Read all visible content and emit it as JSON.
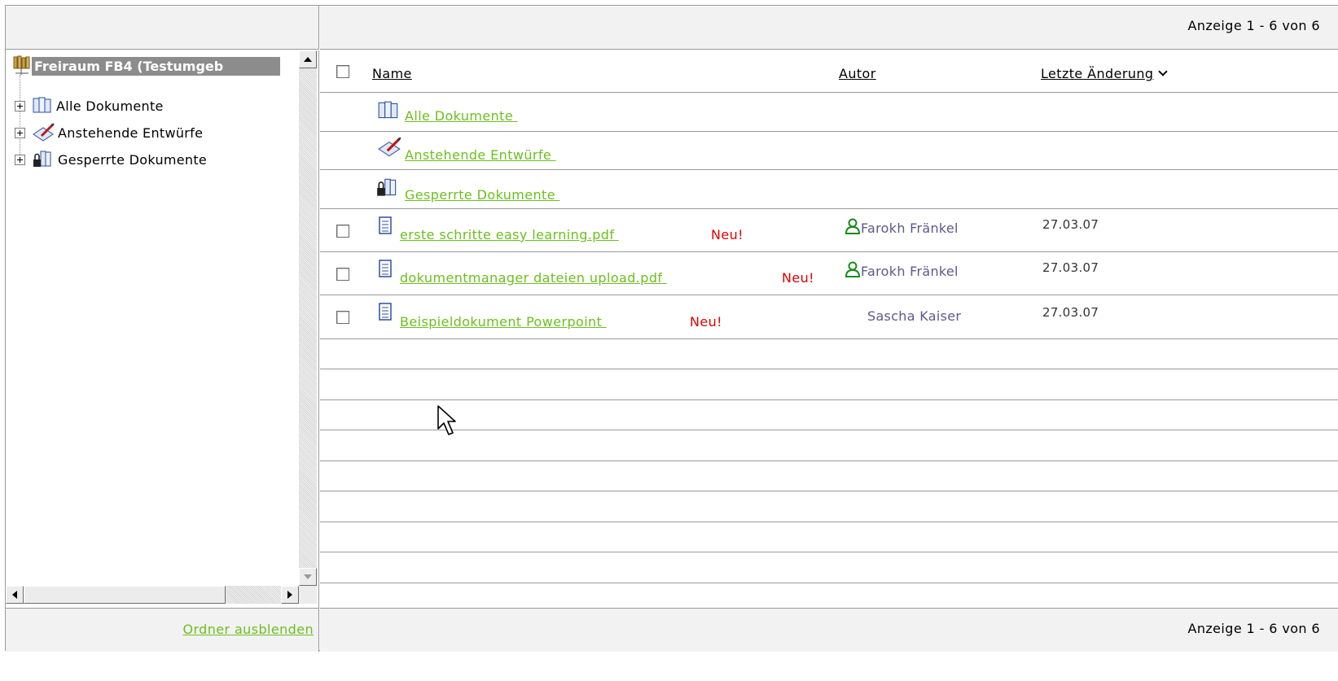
{
  "paging": {
    "top": "Anzeige 1 - 6 von 6",
    "bottom": "Anzeige 1 - 6 von 6"
  },
  "sidebar": {
    "root_label": "Freiraum FB4 (Testumgeb",
    "items": [
      {
        "label": "Alle Dokumente",
        "icon": "documents-icon"
      },
      {
        "label": "Anstehende Entwürfe",
        "icon": "draft-pen-icon"
      },
      {
        "label": "Gesperrte Dokumente",
        "icon": "locked-documents-icon"
      }
    ],
    "footer_link": "Ordner ausblenden"
  },
  "table": {
    "columns": {
      "name": "Name",
      "author": "Autor",
      "modified": "Letzte Änderung"
    },
    "folders": [
      {
        "label": "Alle Dokumente ",
        "icon": "documents-icon"
      },
      {
        "label": "Anstehende Entwürfe ",
        "icon": "draft-pen-icon"
      },
      {
        "label": "Gesperrte Dokumente ",
        "icon": "locked-documents-icon"
      }
    ],
    "files": [
      {
        "name": "erste schritte easy learning.pdf ",
        "badge": "Neu!",
        "author": "Farokh Fränkel",
        "date": "27.03.07",
        "author_icon": "user-icon"
      },
      {
        "name": "dokumentmanager dateien upload.pdf ",
        "badge": "Neu!",
        "author": "Farokh Fränkel",
        "date": "27.03.07",
        "author_icon": "user-icon"
      },
      {
        "name": "Beispieldokument Powerpoint ",
        "badge": "Neu!",
        "author": "Sascha Kaiser",
        "date": "27.03.07"
      }
    ]
  },
  "colors": {
    "link": "#6cbf1e",
    "new_badge": "#e00000",
    "author": "#5a5a8c",
    "header_bg": "#f2f2f2"
  }
}
